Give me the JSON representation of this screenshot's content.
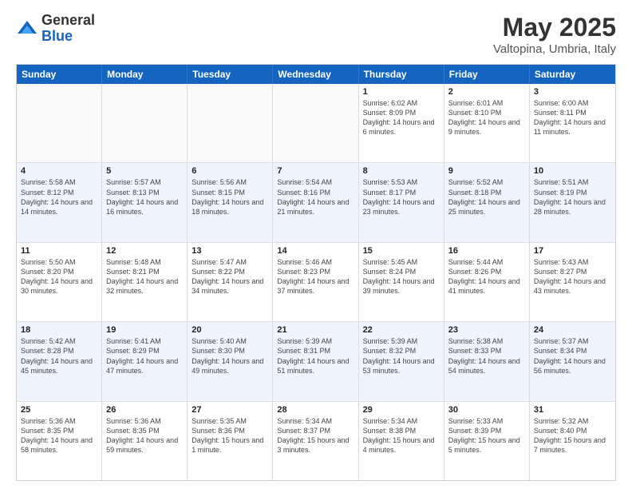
{
  "logo": {
    "general": "General",
    "blue": "Blue"
  },
  "title": "May 2025",
  "location": "Valtopina, Umbria, Italy",
  "weekdays": [
    "Sunday",
    "Monday",
    "Tuesday",
    "Wednesday",
    "Thursday",
    "Friday",
    "Saturday"
  ],
  "rows": [
    [
      {
        "day": "",
        "info": "",
        "empty": true
      },
      {
        "day": "",
        "info": "",
        "empty": true
      },
      {
        "day": "",
        "info": "",
        "empty": true
      },
      {
        "day": "",
        "info": "",
        "empty": true
      },
      {
        "day": "1",
        "info": "Sunrise: 6:02 AM\nSunset: 8:09 PM\nDaylight: 14 hours\nand 6 minutes."
      },
      {
        "day": "2",
        "info": "Sunrise: 6:01 AM\nSunset: 8:10 PM\nDaylight: 14 hours\nand 9 minutes."
      },
      {
        "day": "3",
        "info": "Sunrise: 6:00 AM\nSunset: 8:11 PM\nDaylight: 14 hours\nand 11 minutes."
      }
    ],
    [
      {
        "day": "4",
        "info": "Sunrise: 5:58 AM\nSunset: 8:12 PM\nDaylight: 14 hours\nand 14 minutes."
      },
      {
        "day": "5",
        "info": "Sunrise: 5:57 AM\nSunset: 8:13 PM\nDaylight: 14 hours\nand 16 minutes."
      },
      {
        "day": "6",
        "info": "Sunrise: 5:56 AM\nSunset: 8:15 PM\nDaylight: 14 hours\nand 18 minutes."
      },
      {
        "day": "7",
        "info": "Sunrise: 5:54 AM\nSunset: 8:16 PM\nDaylight: 14 hours\nand 21 minutes."
      },
      {
        "day": "8",
        "info": "Sunrise: 5:53 AM\nSunset: 8:17 PM\nDaylight: 14 hours\nand 23 minutes."
      },
      {
        "day": "9",
        "info": "Sunrise: 5:52 AM\nSunset: 8:18 PM\nDaylight: 14 hours\nand 25 minutes."
      },
      {
        "day": "10",
        "info": "Sunrise: 5:51 AM\nSunset: 8:19 PM\nDaylight: 14 hours\nand 28 minutes."
      }
    ],
    [
      {
        "day": "11",
        "info": "Sunrise: 5:50 AM\nSunset: 8:20 PM\nDaylight: 14 hours\nand 30 minutes."
      },
      {
        "day": "12",
        "info": "Sunrise: 5:48 AM\nSunset: 8:21 PM\nDaylight: 14 hours\nand 32 minutes."
      },
      {
        "day": "13",
        "info": "Sunrise: 5:47 AM\nSunset: 8:22 PM\nDaylight: 14 hours\nand 34 minutes."
      },
      {
        "day": "14",
        "info": "Sunrise: 5:46 AM\nSunset: 8:23 PM\nDaylight: 14 hours\nand 37 minutes."
      },
      {
        "day": "15",
        "info": "Sunrise: 5:45 AM\nSunset: 8:24 PM\nDaylight: 14 hours\nand 39 minutes."
      },
      {
        "day": "16",
        "info": "Sunrise: 5:44 AM\nSunset: 8:26 PM\nDaylight: 14 hours\nand 41 minutes."
      },
      {
        "day": "17",
        "info": "Sunrise: 5:43 AM\nSunset: 8:27 PM\nDaylight: 14 hours\nand 43 minutes."
      }
    ],
    [
      {
        "day": "18",
        "info": "Sunrise: 5:42 AM\nSunset: 8:28 PM\nDaylight: 14 hours\nand 45 minutes."
      },
      {
        "day": "19",
        "info": "Sunrise: 5:41 AM\nSunset: 8:29 PM\nDaylight: 14 hours\nand 47 minutes."
      },
      {
        "day": "20",
        "info": "Sunrise: 5:40 AM\nSunset: 8:30 PM\nDaylight: 14 hours\nand 49 minutes."
      },
      {
        "day": "21",
        "info": "Sunrise: 5:39 AM\nSunset: 8:31 PM\nDaylight: 14 hours\nand 51 minutes."
      },
      {
        "day": "22",
        "info": "Sunrise: 5:39 AM\nSunset: 8:32 PM\nDaylight: 14 hours\nand 53 minutes."
      },
      {
        "day": "23",
        "info": "Sunrise: 5:38 AM\nSunset: 8:33 PM\nDaylight: 14 hours\nand 54 minutes."
      },
      {
        "day": "24",
        "info": "Sunrise: 5:37 AM\nSunset: 8:34 PM\nDaylight: 14 hours\nand 56 minutes."
      }
    ],
    [
      {
        "day": "25",
        "info": "Sunrise: 5:36 AM\nSunset: 8:35 PM\nDaylight: 14 hours\nand 58 minutes."
      },
      {
        "day": "26",
        "info": "Sunrise: 5:36 AM\nSunset: 8:35 PM\nDaylight: 14 hours\nand 59 minutes."
      },
      {
        "day": "27",
        "info": "Sunrise: 5:35 AM\nSunset: 8:36 PM\nDaylight: 15 hours\nand 1 minute."
      },
      {
        "day": "28",
        "info": "Sunrise: 5:34 AM\nSunset: 8:37 PM\nDaylight: 15 hours\nand 3 minutes."
      },
      {
        "day": "29",
        "info": "Sunrise: 5:34 AM\nSunset: 8:38 PM\nDaylight: 15 hours\nand 4 minutes."
      },
      {
        "day": "30",
        "info": "Sunrise: 5:33 AM\nSunset: 8:39 PM\nDaylight: 15 hours\nand 5 minutes."
      },
      {
        "day": "31",
        "info": "Sunrise: 5:32 AM\nSunset: 8:40 PM\nDaylight: 15 hours\nand 7 minutes."
      }
    ]
  ]
}
